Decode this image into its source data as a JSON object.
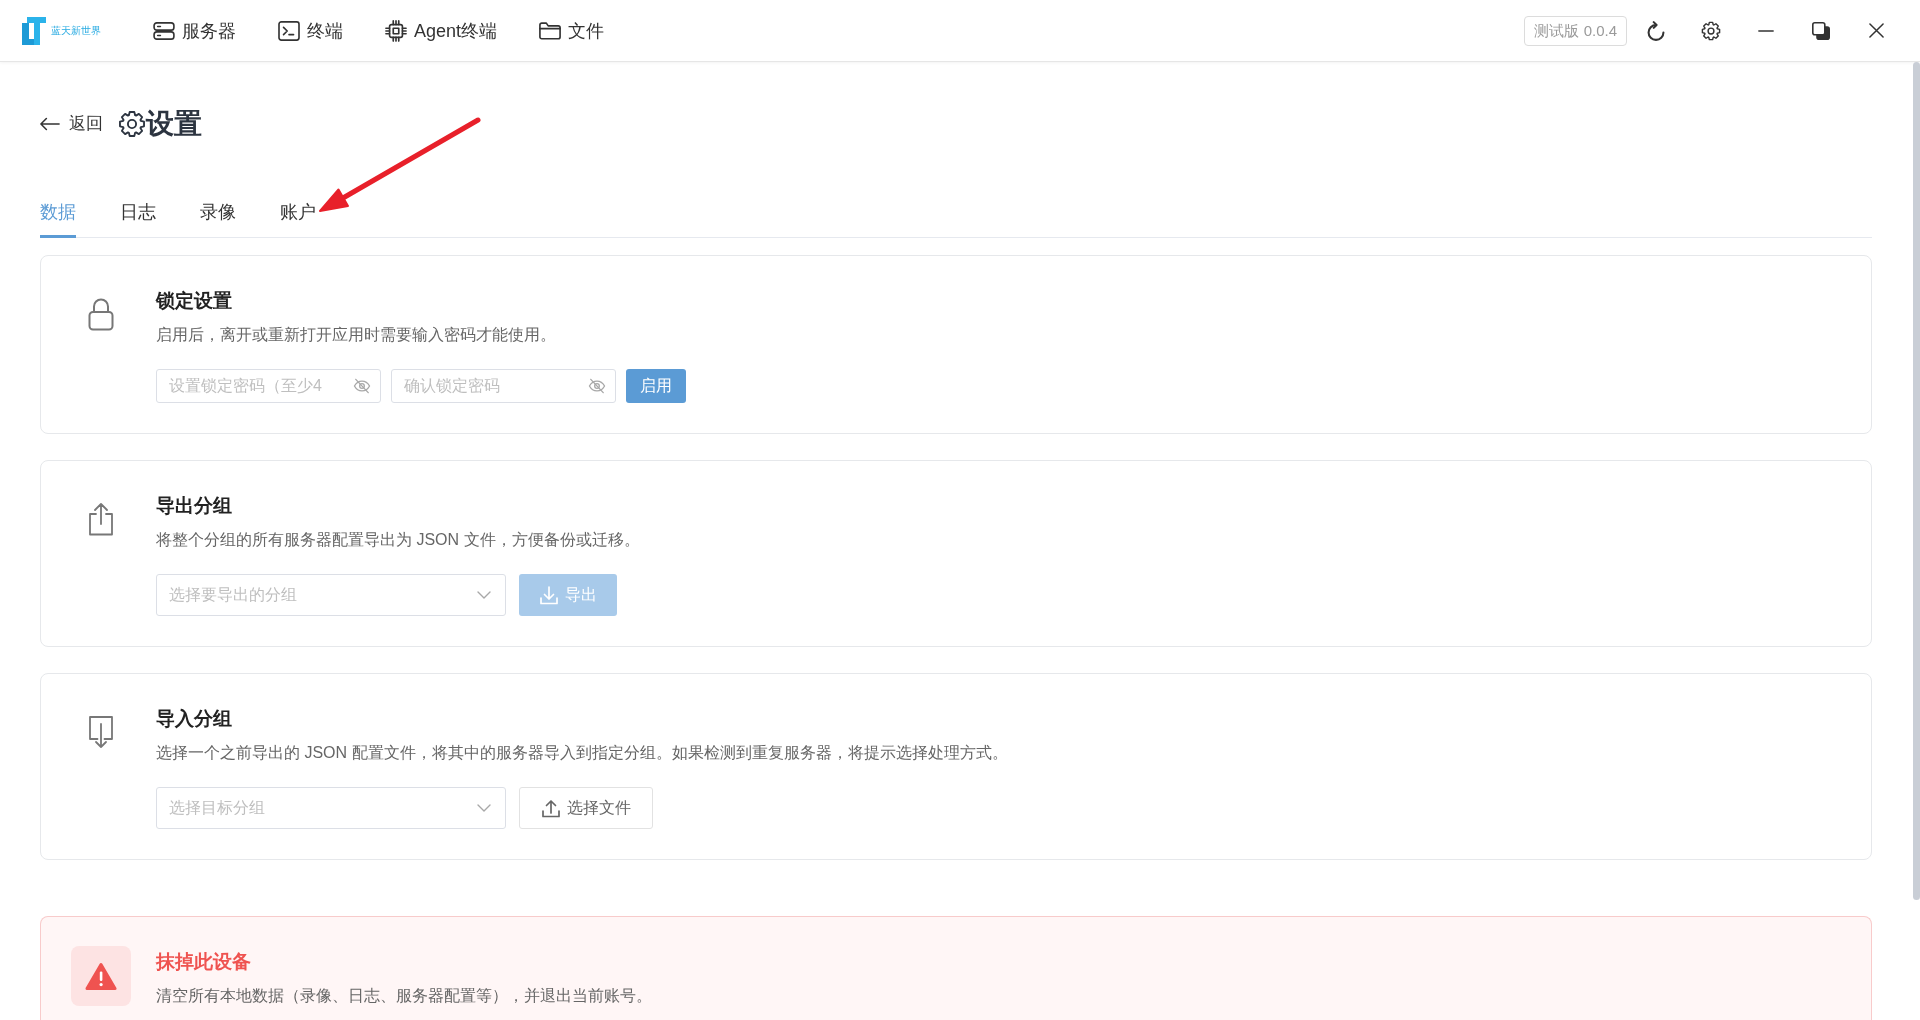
{
  "header": {
    "logo_text": "蓝天新世界",
    "nav": [
      {
        "label": "服务器",
        "kind": "server"
      },
      {
        "label": "终端",
        "kind": "terminal"
      },
      {
        "label": "Agent终端",
        "kind": "chip"
      },
      {
        "label": "文件",
        "kind": "folder"
      }
    ],
    "version": "测试版 0.0.4"
  },
  "page": {
    "back_label": "返回",
    "title": "设置"
  },
  "tabs": [
    {
      "label": "数据",
      "selected": true
    },
    {
      "label": "日志",
      "selected": false
    },
    {
      "label": "录像",
      "selected": false
    },
    {
      "label": "账户",
      "selected": false
    }
  ],
  "sections": [
    {
      "kind": "lock",
      "title": "锁定设置",
      "description": "启用后，离开或重新打开应用时需要输入密码才能使用。",
      "password_fields": [
        {
          "placeholder": "设置锁定密码（至少4"
        },
        {
          "placeholder": "确认锁定密码"
        }
      ],
      "button": {
        "label": "启用",
        "kind": "primary",
        "disabled": false
      }
    },
    {
      "kind": "export",
      "title": "导出分组",
      "description": "将整个分组的所有服务器配置导出为 JSON 文件，方便备份或迁移。",
      "select": {
        "placeholder": "选择要导出的分组"
      },
      "button": {
        "label": "导出",
        "kind": "primary",
        "disabled": true
      }
    },
    {
      "kind": "import",
      "title": "导入分组",
      "description": "选择一个之前导出的 JSON 配置文件，将其中的服务器导入到指定分组。如果检测到重复服务器，将提示选择处理方式。",
      "select": {
        "placeholder": "选择目标分组"
      },
      "button": {
        "label": "选择文件",
        "kind": "plain"
      }
    },
    {
      "kind": "danger",
      "title": "抹掉此设备",
      "description": "清空所有本地数据（录像、日志、服务器配置等），并退出当前账号。"
    }
  ]
}
